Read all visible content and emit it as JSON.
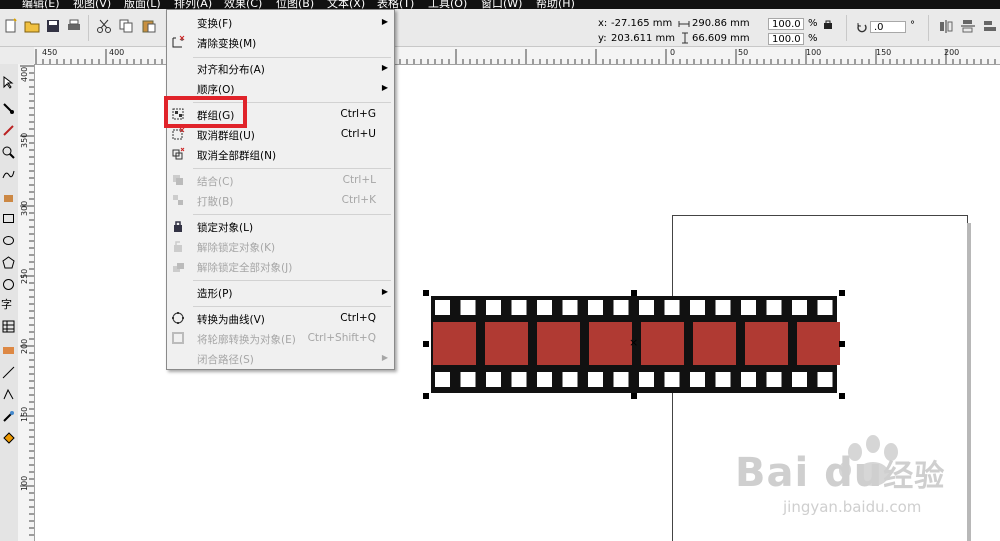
{
  "menubar": {
    "items": [
      {
        "label": "编辑(E)"
      },
      {
        "label": "视图(V)"
      },
      {
        "label": "版面(L)"
      },
      {
        "label": "排列(A)"
      },
      {
        "label": "效果(C)"
      },
      {
        "label": "位图(B)"
      },
      {
        "label": "文本(X)"
      },
      {
        "label": "表格(T)"
      },
      {
        "label": "工具(O)"
      },
      {
        "label": "窗口(W)"
      },
      {
        "label": "帮助(H)"
      }
    ]
  },
  "property_bar": {
    "x_label": "x:",
    "x_value": "-27.165 mm",
    "y_label": "y:",
    "y_value": "203.611 mm",
    "width_value": "290.86 mm",
    "height_value": "66.609 mm",
    "scale_x": "100.0",
    "scale_y": "100.0",
    "percent": "%",
    "rotation_value": ".0",
    "degree": "°"
  },
  "hruler": {
    "labels": [
      "450",
      "400",
      "0",
      "50",
      "100",
      "150",
      "200"
    ]
  },
  "vruler": {
    "labels": [
      "400",
      "350",
      "300",
      "250",
      "200",
      "150",
      "100"
    ]
  },
  "menu": {
    "items": [
      {
        "label": "变换(F)",
        "shortcut": "",
        "submenu": true,
        "disabled": false,
        "icon": ""
      },
      {
        "label": "清除变换(M)",
        "shortcut": "",
        "submenu": false,
        "disabled": false,
        "icon": "clear-transform-icon"
      },
      {
        "label": "对齐和分布(A)",
        "shortcut": "",
        "submenu": true,
        "disabled": false,
        "icon": ""
      },
      {
        "label": "顺序(O)",
        "shortcut": "",
        "submenu": true,
        "disabled": false,
        "icon": ""
      },
      {
        "label": "群组(G)",
        "shortcut": "Ctrl+G",
        "submenu": false,
        "disabled": false,
        "icon": "group-icon"
      },
      {
        "label": "取消群组(U)",
        "shortcut": "Ctrl+U",
        "submenu": false,
        "disabled": false,
        "icon": "ungroup-icon"
      },
      {
        "label": "取消全部群组(N)",
        "shortcut": "",
        "submenu": false,
        "disabled": false,
        "icon": "ungroup-all-icon"
      },
      {
        "label": "结合(C)",
        "shortcut": "Ctrl+L",
        "submenu": false,
        "disabled": true,
        "icon": "combine-icon"
      },
      {
        "label": "打散(B)",
        "shortcut": "Ctrl+K",
        "submenu": false,
        "disabled": true,
        "icon": "break-apart-icon"
      },
      {
        "label": "锁定对象(L)",
        "shortcut": "",
        "submenu": false,
        "disabled": false,
        "icon": "lock-icon"
      },
      {
        "label": "解除锁定对象(K)",
        "shortcut": "",
        "submenu": false,
        "disabled": true,
        "icon": "unlock-icon"
      },
      {
        "label": "解除锁定全部对象(J)",
        "shortcut": "",
        "submenu": false,
        "disabled": true,
        "icon": "unlock-all-icon"
      },
      {
        "label": "造形(P)",
        "shortcut": "",
        "submenu": true,
        "disabled": false,
        "icon": ""
      },
      {
        "label": "转换为曲线(V)",
        "shortcut": "Ctrl+Q",
        "submenu": false,
        "disabled": false,
        "icon": "convert-to-curves-icon"
      },
      {
        "label": "将轮廓转换为对象(E)",
        "shortcut": "Ctrl+Shift+Q",
        "submenu": false,
        "disabled": true,
        "icon": "outline-to-object-icon"
      },
      {
        "label": "闭合路径(S)",
        "shortcut": "",
        "submenu": true,
        "disabled": true,
        "icon": ""
      }
    ]
  },
  "colors": {
    "film_black": "#111111",
    "frame_red": "#b03a33",
    "highlight_red": "#e0232a",
    "menubar": "#111111"
  },
  "watermark": {
    "brand": "Bai du",
    "brand_cn": "经验",
    "url": "jingyan.baidu.com"
  }
}
